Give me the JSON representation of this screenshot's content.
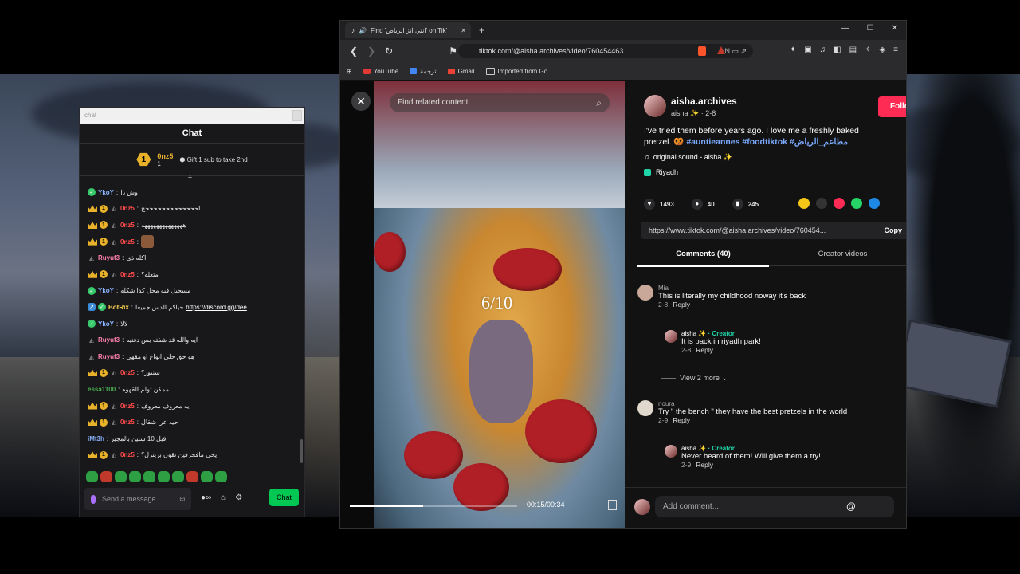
{
  "chat": {
    "window_title": "chat",
    "title": "Chat",
    "leader": {
      "rank": "1",
      "name": "0nz5",
      "count": "1",
      "gift_text": "Gift 1 sub to take 2nd"
    },
    "messages": [
      {
        "user": "YkoY",
        "user_color": "#8ab4ff",
        "badges": [
          "check"
        ],
        "text": "وش ذا"
      },
      {
        "user": "0nz5",
        "user_color": "#ff4b4b",
        "badges": [
          "crown",
          "one",
          "grey"
        ],
        "text": "احححححححححححححح"
      },
      {
        "user": "0nz5",
        "user_color": "#ff4b4b",
        "badges": [
          "crown",
          "one",
          "grey"
        ],
        "text": "ههههههههههههههه"
      },
      {
        "user": "0nz5",
        "user_color": "#ff4b4b",
        "badges": [
          "crown",
          "one",
          "grey"
        ],
        "text": "",
        "emote": true
      },
      {
        "user": "Ruyuf3",
        "user_color": "#ff80ab",
        "badges": [
          "grey"
        ],
        "text": "اكله ذي"
      },
      {
        "user": "0nz5",
        "user_color": "#ff4b4b",
        "badges": [
          "crown",
          "one",
          "grey"
        ],
        "text": "متعله؟"
      },
      {
        "user": "YkoY",
        "user_color": "#8ab4ff",
        "badges": [
          "check"
        ],
        "text": "مسجيل فيه محل كذا شكله"
      },
      {
        "user": "BotRix",
        "user_color": "#ffd54f",
        "badges": [
          "pink",
          "check"
        ],
        "text": "حياكم الدس جميعا",
        "link": "https://discord.gg/dee"
      },
      {
        "user": "YkoY",
        "user_color": "#8ab4ff",
        "badges": [
          "check"
        ],
        "text": "لالا"
      },
      {
        "user": "Ruyuf3",
        "user_color": "#ff80ab",
        "badges": [
          "grey"
        ],
        "text": "ايه والله قد شفته بس دفنيه"
      },
      {
        "user": "Ruyuf3",
        "user_color": "#ff80ab",
        "badges": [
          "grey"
        ],
        "text": "هو حق حلى انواع او مقهى"
      },
      {
        "user": "0nz5",
        "user_color": "#ff4b4b",
        "badges": [
          "crown",
          "one",
          "grey"
        ],
        "text": "ستيور؟"
      },
      {
        "user": "essa1100",
        "user_color": "#4caf50",
        "badges": [],
        "text": "ممكن تولم القهوه"
      },
      {
        "user": "0nz5",
        "user_color": "#ff4b4b",
        "badges": [
          "crown",
          "one",
          "grey"
        ],
        "text": "ايه معروف معروف"
      },
      {
        "user": "0nz5",
        "user_color": "#ff4b4b",
        "badges": [
          "crown",
          "one",
          "grey"
        ],
        "text": "حيه عرا شقال"
      },
      {
        "user": "iMt3h",
        "user_color": "#8ab4ff",
        "badges": [],
        "text": "قبل 10 سنين بالمجيز"
      },
      {
        "user": "0nz5",
        "user_color": "#ff4b4b",
        "badges": [
          "crown",
          "one",
          "grey"
        ],
        "text": "يخي مافحرفين تقون بريتزل؟"
      }
    ],
    "input_placeholder": "Send a message",
    "chat_button": "Chat"
  },
  "browser": {
    "tab_title": "Find 'انتي انز الرياض' on TikTok",
    "url": "tiktok.com/@aisha.archives/video/760454463...",
    "brave_badge": "8",
    "bookmarks": [
      "YouTube",
      "ترجمة",
      "Gmail",
      "Imported from Go..."
    ]
  },
  "video": {
    "search_placeholder": "Find related content",
    "overlay_text": "6/10",
    "time": "00:15/00:34",
    "progress": 0.44
  },
  "post": {
    "author": "aisha.archives",
    "sub": "aisha ✨ · 2-8",
    "follow": "Follow",
    "desc_text": "I've tried them before years ago. I love me a freshly baked pretzel. 🥨 ",
    "tags": [
      "#auntieannes",
      "#foodtiktok",
      "#مطاعم_الرياض"
    ],
    "sound": "original sound - aisha ✨",
    "location": "Riyadh",
    "likes": "1493",
    "comments": "40",
    "saves": "245",
    "link": "https://www.tiktok.com/@aisha.archives/video/760454...",
    "copy": "Copy",
    "tab_comments": "Comments (40)",
    "tab_creator": "Creator videos",
    "comment_list": [
      {
        "name": "Mia",
        "text": "This is literally my childhood noway it's back",
        "date": "2-8",
        "reply": "Reply"
      },
      {
        "name": "aisha ✨",
        "creator": "· Creator",
        "text": "It is back in riyadh park!",
        "date": "2-8",
        "reply": "Reply"
      },
      {
        "name": "noura",
        "text": "Try \" the bench \" they have the best pretzels in the world",
        "date": "2-9",
        "reply": "Reply"
      },
      {
        "name": "aisha ✨",
        "creator": "· Creator",
        "text": "Never heard of them! Will give them a try!",
        "date": "2-9",
        "reply": "Reply"
      }
    ],
    "view_more": "View 2 more",
    "add_comment": "Add comment..."
  }
}
